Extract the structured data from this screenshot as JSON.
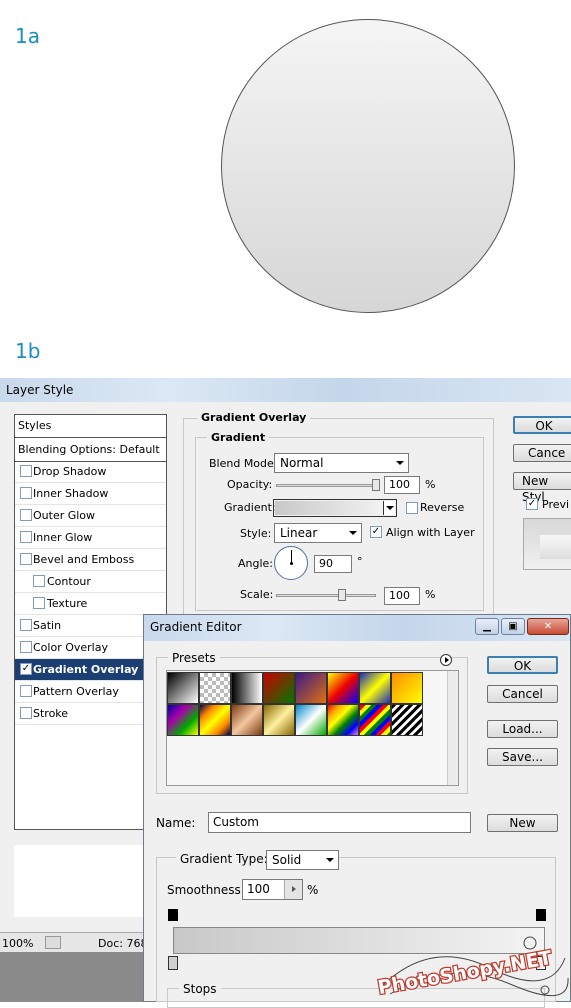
{
  "labels": {
    "step_1a": "1a",
    "step_1b": "1b"
  },
  "layer_style": {
    "title": "Layer Style",
    "styles_header": "Styles",
    "blending_options": "Blending Options: Default",
    "style_items": [
      {
        "label": "Drop Shadow",
        "checked": false,
        "selected": false,
        "sub": false
      },
      {
        "label": "Inner Shadow",
        "checked": false,
        "selected": false,
        "sub": false
      },
      {
        "label": "Outer Glow",
        "checked": false,
        "selected": false,
        "sub": false
      },
      {
        "label": "Inner Glow",
        "checked": false,
        "selected": false,
        "sub": false
      },
      {
        "label": "Bevel and Emboss",
        "checked": false,
        "selected": false,
        "sub": false
      },
      {
        "label": "Contour",
        "checked": false,
        "selected": false,
        "sub": true
      },
      {
        "label": "Texture",
        "checked": false,
        "selected": false,
        "sub": true
      },
      {
        "label": "Satin",
        "checked": false,
        "selected": false,
        "sub": false
      },
      {
        "label": "Color Overlay",
        "checked": false,
        "selected": false,
        "sub": false
      },
      {
        "label": "Gradient Overlay",
        "checked": true,
        "selected": true,
        "sub": false
      },
      {
        "label": "Pattern Overlay",
        "checked": false,
        "selected": false,
        "sub": false
      },
      {
        "label": "Stroke",
        "checked": false,
        "selected": false,
        "sub": false
      }
    ],
    "section_title": "Gradient Overlay",
    "group_title": "Gradient",
    "blend_mode_label": "Blend Mode:",
    "blend_mode_value": "Normal",
    "opacity_label": "Opacity:",
    "opacity_value": "100",
    "opacity_level": 1.0,
    "percent": "%",
    "gradient_label": "Gradient:",
    "reverse_label": "Reverse",
    "reverse_checked": false,
    "style_label": "Style:",
    "style_value": "Linear",
    "align_label": "Align with Layer",
    "align_checked": true,
    "angle_label": "Angle:",
    "angle_value": "90",
    "degree": "°",
    "scale_label": "Scale:",
    "scale_value": "100",
    "scale_level": 0.5,
    "ok_button": "OK",
    "cancel_button": "Cance",
    "new_style_button": "New Styl",
    "preview_label": "Previ",
    "preview_checked": true
  },
  "gradient_editor": {
    "title": "Gradient Editor",
    "presets_label": "Presets",
    "ok_button": "OK",
    "cancel_button": "Cancel",
    "load_button": "Load...",
    "save_button": "Save...",
    "name_label": "Name:",
    "name_value": "Custom",
    "new_button": "New",
    "gradient_type_label": "Gradient Type:",
    "gradient_type_value": "Solid",
    "smoothness_label": "Smoothness:",
    "smoothness_value": "100",
    "percent": "%",
    "stops_label": "Stops"
  },
  "status_bar": {
    "zoom": "100%",
    "doc": "Doc: 768"
  },
  "watermark": "PhotoShopy.NET"
}
